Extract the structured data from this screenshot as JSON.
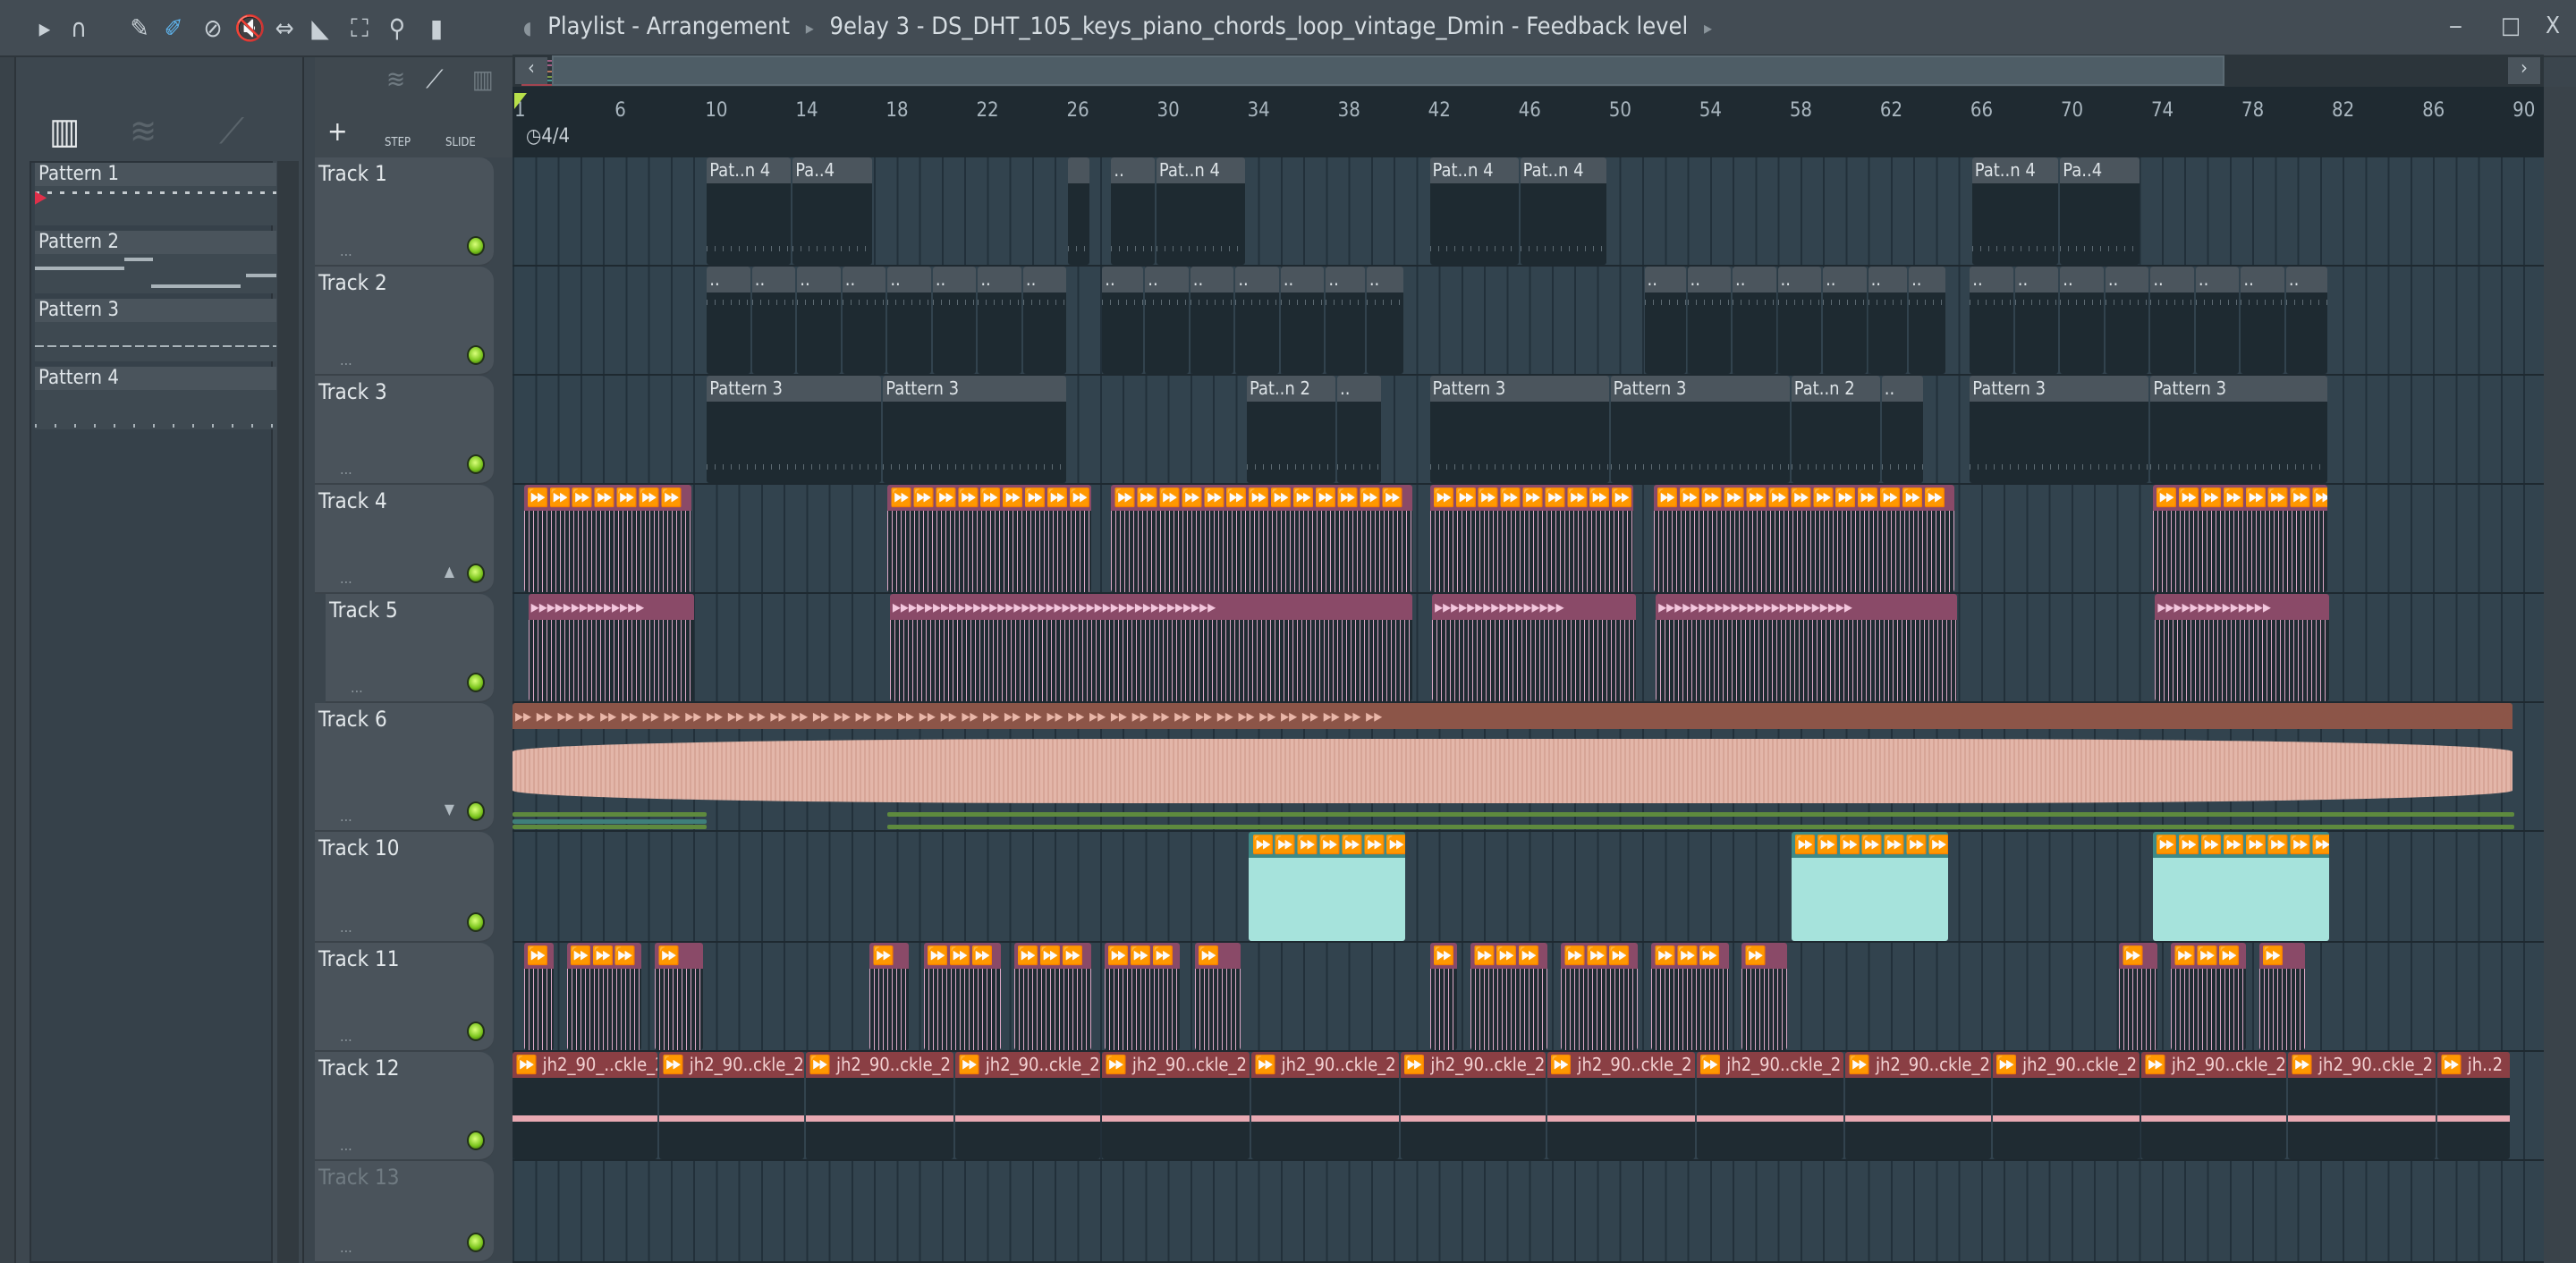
{
  "toolbar": {
    "icons": [
      "play-arrow-icon",
      "magnet-snap-icon",
      "pencil-draw-icon",
      "paint-brush-icon",
      "delete-icon",
      "mute-icon",
      "slip-icon",
      "slice-icon",
      "select-icon",
      "zoom-icon",
      "playback-icon"
    ],
    "breadcrumb": [
      "Playlist - Arrangement",
      "9elay 3 - DS_DHT_105_keys_piano_chords_loop_vintage_Dmin - Feedback level"
    ]
  },
  "window": {
    "minimize": "‒",
    "maximize": "□",
    "close": "X"
  },
  "left_panel": {
    "patterns": [
      "Pattern 1",
      "Pattern 2",
      "Pattern 3",
      "Pattern 4"
    ]
  },
  "header_tools": {
    "add": "+",
    "step": "STEP",
    "slide": "SLIDE"
  },
  "ruler": {
    "bars": [
      1,
      6,
      10,
      14,
      18,
      22,
      26,
      30,
      34,
      38,
      42,
      46,
      50,
      54,
      58,
      62,
      66,
      70,
      74,
      78,
      82,
      86,
      90
    ],
    "time_signature": "4/4"
  },
  "tracks": [
    {
      "name": "Track 1",
      "type": "pc",
      "clips": [
        [
          9.6,
          13.4,
          "Pat..n 4"
        ],
        [
          13.4,
          17,
          "Pa..4"
        ],
        [
          25.6,
          26.6,
          ""
        ],
        [
          27.5,
          29.5,
          ".."
        ],
        [
          29.5,
          33.5,
          "Pat..n 4"
        ],
        [
          41.6,
          45.6,
          "Pat..n 4"
        ],
        [
          45.6,
          49.5,
          "Pat..n 4"
        ],
        [
          65.6,
          69.5,
          "Pat..n 4"
        ],
        [
          69.5,
          73.1,
          "Pa..4"
        ]
      ]
    },
    {
      "name": "Track 2",
      "type": "pc",
      "clips": [
        [
          9.6,
          11.6,
          ".."
        ],
        [
          11.6,
          13.6,
          ".."
        ],
        [
          13.6,
          15.6,
          ".."
        ],
        [
          15.6,
          17.6,
          ".."
        ],
        [
          17.6,
          19.6,
          ".."
        ],
        [
          19.6,
          21.6,
          ".."
        ],
        [
          21.6,
          23.6,
          ".."
        ],
        [
          23.6,
          25.6,
          ".."
        ],
        [
          27.1,
          29,
          ".."
        ],
        [
          29,
          31,
          ".."
        ],
        [
          31,
          33,
          ".."
        ],
        [
          33,
          35,
          ".."
        ],
        [
          35,
          37,
          ".."
        ],
        [
          37,
          38.8,
          ".."
        ],
        [
          38.8,
          40.5,
          ".."
        ],
        [
          51.1,
          53,
          ".."
        ],
        [
          53,
          55,
          ".."
        ],
        [
          55,
          57,
          ".."
        ],
        [
          57,
          59,
          ".."
        ],
        [
          59,
          61,
          ".."
        ],
        [
          61,
          62.8,
          ".."
        ],
        [
          62.8,
          64.5,
          ".."
        ],
        [
          65.5,
          67.5,
          ".."
        ],
        [
          67.5,
          69.5,
          ".."
        ],
        [
          69.5,
          71.5,
          ".."
        ],
        [
          71.5,
          73.5,
          ".."
        ],
        [
          73.5,
          75.5,
          ".."
        ],
        [
          75.5,
          77.5,
          ".."
        ],
        [
          77.5,
          79.5,
          ".."
        ],
        [
          79.5,
          81.4,
          ".."
        ]
      ]
    },
    {
      "name": "Track 3",
      "type": "pc",
      "clips": [
        [
          9.6,
          17.4,
          "Pattern 3"
        ],
        [
          17.4,
          25.6,
          "Pattern 3"
        ],
        [
          33.5,
          37.5,
          "Pat..n 2"
        ],
        [
          37.5,
          39.5,
          ".."
        ],
        [
          41.6,
          49.6,
          "Pattern 3"
        ],
        [
          49.6,
          57.6,
          "Pattern 3"
        ],
        [
          57.6,
          61.6,
          "Pat..n 2"
        ],
        [
          61.6,
          63.5,
          ".."
        ],
        [
          65.5,
          73.5,
          "Pattern 3"
        ],
        [
          73.5,
          81.4,
          "Pattern 3"
        ]
      ]
    },
    {
      "name": "Track 4",
      "type": "pink",
      "clips": [
        [
          1.5,
          9,
          "⏩⏩⏩⏩⏩⏩⏩"
        ],
        [
          17.6,
          26.7,
          "⏩⏩⏩⏩⏩⏩⏩⏩⏩"
        ],
        [
          27.5,
          40.9,
          "⏩⏩⏩⏩⏩⏩⏩⏩⏩⏩⏩⏩⏩"
        ],
        [
          41.6,
          50.7,
          "⏩⏩⏩⏩⏩⏩⏩⏩⏩"
        ],
        [
          51.5,
          64.9,
          "⏩⏩⏩⏩⏩⏩⏩⏩⏩⏩⏩⏩⏩"
        ],
        [
          73.6,
          81.4,
          "⏩⏩⏩⏩⏩⏩⏩⏩"
        ]
      ]
    },
    {
      "name": "Track 5",
      "type": "pink",
      "clips": [
        [
          1.7,
          9.1,
          "▸▸▸▸▸▸▸▸▸▸▸▸▸▸"
        ],
        [
          17.7,
          40.9,
          "▸▸▸▸▸▸▸▸▸▸▸▸▸▸▸▸▸▸▸▸▸▸▸▸▸▸▸▸▸▸▸▸▸▸▸▸▸▸▸▸"
        ],
        [
          41.7,
          50.8,
          "▸▸▸▸▸▸▸▸▸▸▸▸▸▸▸▸"
        ],
        [
          51.6,
          65,
          "▸▸▸▸▸▸▸▸▸▸▸▸▸▸▸▸▸▸▸▸▸▸▸▸"
        ],
        [
          73.7,
          81.5,
          "▸▸▸▸▸▸▸▸▸▸▸▸▸▸"
        ]
      ]
    },
    {
      "name": "Track 6",
      "type": "brown",
      "clips": [
        [
          1,
          89.6,
          "▸▸ ▸▸ ▸▸ ▸▸ ▸▸ ▸▸ ▸▸ ▸▸ ▸▸ ▸▸ ▸▸ ▸▸ ▸▸ ▸▸ ▸▸ ▸▸ ▸▸ ▸▸ ▸▸ ▸▸ ▸▸ ▸▸ ▸▸ ▸▸ ▸▸ ▸▸ ▸▸ ▸▸ ▸▸ ▸▸ ▸▸ ▸▸ ▸▸ ▸▸ ▸▸ ▸▸ ▸▸ ▸▸ ▸▸ ▸▸ ▸▸"
        ]
      ]
    },
    {
      "name": "Track 10",
      "type": "teal",
      "clips": [
        [
          33.6,
          40.6,
          "⏩⏩⏩⏩⏩⏩⏩"
        ],
        [
          57.6,
          64.6,
          "⏩⏩⏩⏩⏩⏩⏩"
        ],
        [
          73.6,
          81.5,
          "⏩⏩⏩⏩⏩⏩⏩⏩"
        ]
      ]
    },
    {
      "name": "Track 11",
      "type": "pink",
      "clips": [
        [
          1.5,
          2.9,
          "⏩"
        ],
        [
          3.4,
          6.8,
          "⏩⏩⏩"
        ],
        [
          7.3,
          9.5,
          "⏩"
        ],
        [
          16.8,
          18.6,
          "⏩"
        ],
        [
          19.2,
          22.7,
          "⏩⏩⏩"
        ],
        [
          23.2,
          26.7,
          "⏩⏩⏩"
        ],
        [
          27.2,
          30.6,
          "⏩⏩⏩"
        ],
        [
          31.2,
          33.3,
          "⏩"
        ],
        [
          41.6,
          42.9,
          "⏩"
        ],
        [
          43.4,
          46.9,
          "⏩⏩⏩"
        ],
        [
          47.4,
          50.9,
          "⏩⏩⏩"
        ],
        [
          51.4,
          54.9,
          "⏩⏩⏩"
        ],
        [
          55.4,
          57.5,
          "⏩"
        ],
        [
          72.1,
          73.9,
          "⏩"
        ],
        [
          74.4,
          77.8,
          "⏩⏩⏩"
        ],
        [
          78.3,
          80.4,
          "⏩"
        ]
      ]
    },
    {
      "name": "Track 12",
      "type": "red",
      "clips": [
        [
          1,
          7.5,
          "⏩ jh2_90_..ckle_2"
        ],
        [
          7.5,
          14,
          "⏩ jh2_90..ckle_2"
        ],
        [
          14,
          20.6,
          "⏩ jh2_90..ckle_2"
        ],
        [
          20.6,
          27.1,
          "⏩ jh2_90..ckle_2"
        ],
        [
          27.1,
          33.7,
          "⏩ jh2_90..ckle_2"
        ],
        [
          33.7,
          40.3,
          "⏩ jh2_90..ckle_2"
        ],
        [
          40.3,
          46.8,
          "⏩ jh2_90..ckle_2"
        ],
        [
          46.8,
          53.4,
          "⏩ jh2_90..ckle_2"
        ],
        [
          53.4,
          60,
          "⏩ jh2_90..ckle_2"
        ],
        [
          60,
          66.5,
          "⏩ jh2_90..ckle_2"
        ],
        [
          66.5,
          73.1,
          "⏩ jh2_90..ckle_2"
        ],
        [
          73.1,
          79.6,
          "⏩ jh2_90..ckle_2"
        ],
        [
          79.6,
          86.2,
          "⏩ jh2_90..ckle_2"
        ],
        [
          86.2,
          89.5,
          "⏩ jh..2"
        ]
      ]
    },
    {
      "name": "Track 13",
      "type": "pc",
      "clips": []
    }
  ],
  "colors": {
    "accent_green": "#7ac21a",
    "pink": "#8a4a68",
    "teal": "#3f8a86",
    "brown": "#8c5548",
    "red": "#8a3f44"
  }
}
